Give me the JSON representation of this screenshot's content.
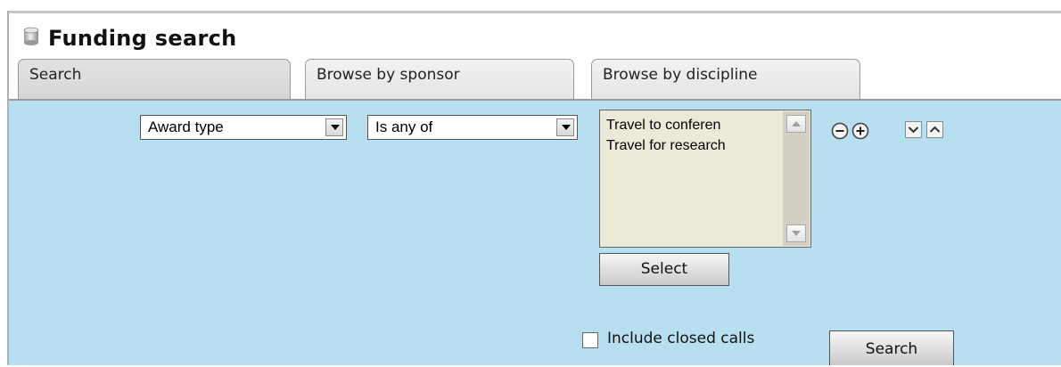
{
  "page": {
    "title": "Funding search",
    "title_icon": "database-icon"
  },
  "tabs": [
    {
      "label": "Search",
      "active": true
    },
    {
      "label": "Browse by sponsor",
      "active": false
    },
    {
      "label": "Browse by discipline",
      "active": false
    }
  ],
  "criteria": {
    "field_select": {
      "value": "Award type"
    },
    "operator_select": {
      "value": "Is any of"
    },
    "values_list": {
      "options": [
        "Travel to conferen",
        "Travel for research"
      ]
    },
    "select_button_label": "Select",
    "row_icons": [
      "remove-circle-icon",
      "add-circle-icon",
      "move-down-icon",
      "move-up-icon"
    ]
  },
  "footer": {
    "include_closed_label": "Include closed calls",
    "include_closed_checked": false,
    "search_button_label": "Search"
  },
  "colors": {
    "panel_background": "#b7dff0",
    "listbox_background": "#ece9d8"
  }
}
